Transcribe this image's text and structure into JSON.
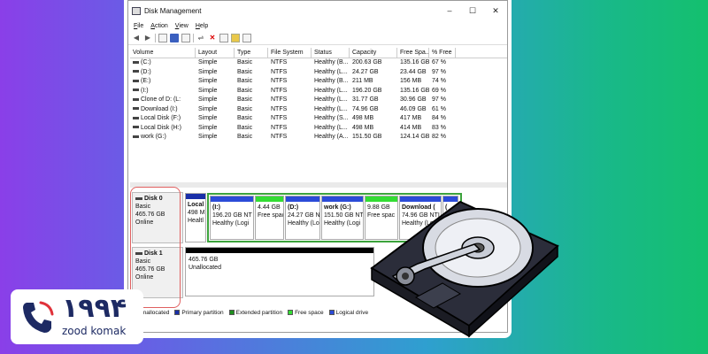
{
  "window": {
    "title": "Disk Management",
    "controls": [
      "–",
      "☐",
      "✕"
    ]
  },
  "menu": [
    "File",
    "Action",
    "View",
    "Help"
  ],
  "volume_table": {
    "headers": [
      "Volume",
      "Layout",
      "Type",
      "File System",
      "Status",
      "Capacity",
      "Free Spa...",
      "% Free"
    ],
    "rows": [
      [
        "(C:)",
        "Simple",
        "Basic",
        "NTFS",
        "Healthy (B...",
        "200.63 GB",
        "135.16 GB",
        "67 %"
      ],
      [
        "(D:)",
        "Simple",
        "Basic",
        "NTFS",
        "Healthy (L...",
        "24.27 GB",
        "23.44 GB",
        "97 %"
      ],
      [
        "(E:)",
        "Simple",
        "Basic",
        "NTFS",
        "Healthy (B...",
        "211 MB",
        "156 MB",
        "74 %"
      ],
      [
        "(I:)",
        "Simple",
        "Basic",
        "NTFS",
        "Healthy (L...",
        "196.20 GB",
        "135.16 GB",
        "69 %"
      ],
      [
        "Clone of D: (L:",
        "Simple",
        "Basic",
        "NTFS",
        "Healthy (L...",
        "31.77 GB",
        "30.96 GB",
        "97 %"
      ],
      [
        "Download (I:)",
        "Simple",
        "Basic",
        "NTFS",
        "Healthy (L...",
        "74.96 GB",
        "46.09 GB",
        "61 %"
      ],
      [
        "Local Disk (F:)",
        "Simple",
        "Basic",
        "NTFS",
        "Healthy (S...",
        "498 MB",
        "417 MB",
        "84 %"
      ],
      [
        "Local Disk (H:)",
        "Simple",
        "Basic",
        "NTFS",
        "Healthy (L...",
        "498 MB",
        "414 MB",
        "83 %"
      ],
      [
        "work (G:)",
        "Simple",
        "Basic",
        "NTFS",
        "Healthy (A...",
        "151.50 GB",
        "124.14 GB",
        "82 %"
      ]
    ]
  },
  "disks": [
    {
      "name": "Disk 0",
      "type": "Basic",
      "size": "465.76 GB",
      "status": "Online",
      "partitions": [
        {
          "name": "Local",
          "size": "498 M",
          "status": "Healtl",
          "kind": "primary"
        },
        {
          "name": "(I:)",
          "size": "196.20 GB NT",
          "status": "Healthy (Logi",
          "kind": "logical"
        },
        {
          "name": "",
          "size": "4.44 GB",
          "status": "Free spac",
          "kind": "free"
        },
        {
          "name": "(D:)",
          "size": "24.27 GB NT",
          "status": "Healthy (Logi",
          "kind": "logical"
        },
        {
          "name": "work (G:)",
          "size": "151.50 GB NTI",
          "status": "Healthy (Logi",
          "kind": "logical"
        },
        {
          "name": "",
          "size": "9.88 GB",
          "status": "Free spac",
          "kind": "free"
        },
        {
          "name": "Download (",
          "size": "74.96 GB NTI",
          "status": "Healthy (Logi",
          "kind": "logical"
        },
        {
          "name": "(",
          "size": "",
          "status": "",
          "kind": "logical"
        }
      ]
    },
    {
      "name": "Disk 1",
      "type": "Basic",
      "size": "465.76 GB",
      "status": "Online",
      "unallocated": {
        "size": "465.76 GB",
        "label": "Unallocated"
      }
    }
  ],
  "legend": [
    {
      "label": "Unallocated",
      "color": "#000000"
    },
    {
      "label": "Primary partition",
      "color": "#1a2fa8"
    },
    {
      "label": "Extended partition",
      "color": "#1f8f1f"
    },
    {
      "label": "Free space",
      "color": "#33dd33"
    },
    {
      "label": "Logical drive",
      "color": "#2b4bd8"
    }
  ],
  "colors": {
    "primary_band": "#1a2fa8",
    "logical_band": "#2b4bd8",
    "free_band": "#33dd33",
    "extended_border": "#3ca33c",
    "highlight": "#e06060",
    "logo": "#1d2a63"
  },
  "logo": {
    "number": "۱۹۹۴",
    "sub": "zood komak",
    "icon": "phone-icon"
  }
}
